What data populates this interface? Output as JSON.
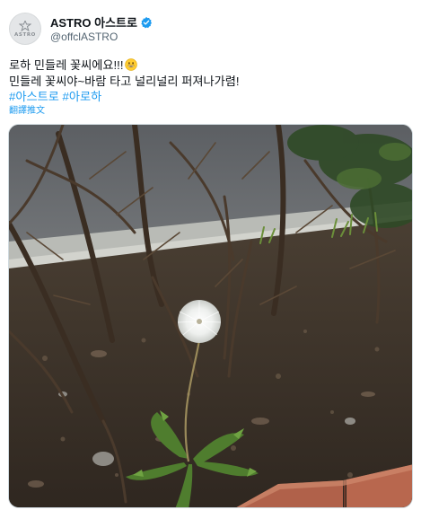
{
  "account": {
    "display_name": "ASTRO 아스트로",
    "handle": "@offclASTRO",
    "avatar_text": "ASTRO",
    "verified": true,
    "verified_icon": "verified-badge-icon"
  },
  "tweet": {
    "line1": "로하 민들레 꽃씨에요!!!",
    "line1_emoji": "grinning-face-emoji",
    "line2": "민들레 꽃씨야~바람 타고 널리널리 퍼져나가렴!",
    "hashtags": [
      "#아스트로",
      "#아로하"
    ],
    "translate_label": "翻譯推文"
  },
  "media": {
    "type": "photo",
    "icon": "photo-dandelion"
  },
  "colors": {
    "link": "#1d9bf0",
    "verified": "#1d9bf0",
    "text": "#0f1419",
    "secondary": "#536471"
  }
}
